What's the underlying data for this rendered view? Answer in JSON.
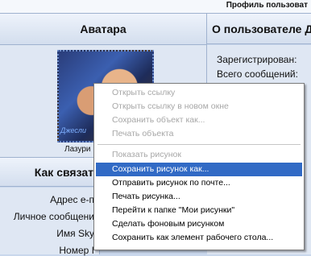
{
  "top": {
    "title": "Профиль пользоват"
  },
  "headers": {
    "avatar": "Аватара",
    "about": "О пользователе Д",
    "contact": "Как связат"
  },
  "avatar": {
    "signature": "Джесли",
    "name": "Лазури"
  },
  "about_rows": [
    "Зарегистрирован:",
    "Всего сообщений:"
  ],
  "contact_rows": [
    "Адрес e-п",
    "Личное сообщени",
    "Имя Sky",
    "Номер I"
  ],
  "menu": {
    "items": [
      {
        "label": "Открыть ссылку",
        "disabled": true
      },
      {
        "label": "Открыть ссылку в новом окне",
        "disabled": true
      },
      {
        "label": "Сохранить объект как...",
        "disabled": true
      },
      {
        "label": "Печать объекта",
        "disabled": true
      },
      {
        "label": "Показать рисунок",
        "disabled": true
      },
      {
        "label": "Сохранить рисунок как...",
        "selected": true
      },
      {
        "label": "Отправить рисунок по почте...",
        "disabled": false
      },
      {
        "label": "Печать рисунка...",
        "disabled": false
      },
      {
        "label": "Перейти к папке \"Мои рисунки\"",
        "disabled": false
      },
      {
        "label": "Сделать фоновым рисунком",
        "disabled": false
      },
      {
        "label": "Сохранить как элемент рабочего стола...",
        "disabled": false
      }
    ]
  },
  "colors": {
    "background": "#c9d7ec",
    "cell": "#dfe7f3",
    "selection": "#316ac5",
    "disabled_text": "#a7a7a7"
  }
}
